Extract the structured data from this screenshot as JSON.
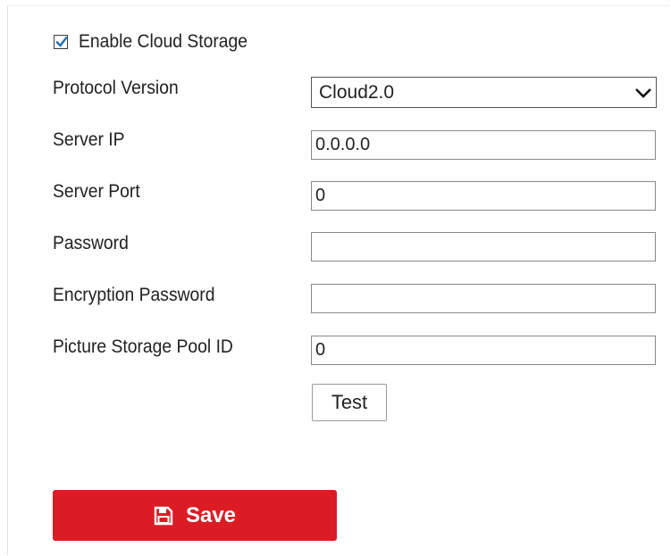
{
  "cloud_storage": {
    "enable_label": "Enable Cloud Storage",
    "enabled": true
  },
  "form": {
    "protocol_version": {
      "label": "Protocol Version",
      "value": "Cloud2.0"
    },
    "server_ip": {
      "label": "Server IP",
      "value": "0.0.0.0"
    },
    "server_port": {
      "label": "Server Port",
      "value": "0"
    },
    "password": {
      "label": "Password",
      "value": ""
    },
    "encryption_password": {
      "label": "Encryption Password",
      "value": ""
    },
    "picture_storage_pool_id": {
      "label": "Picture Storage Pool ID",
      "value": "0"
    }
  },
  "buttons": {
    "test_label": "Test",
    "save_label": "Save"
  },
  "icons": {
    "checkbox_check": "check-icon",
    "select_chevron": "chevron-down-icon",
    "save": "floppy-disk-icon"
  },
  "colors": {
    "save_button_bg": "#dc1c24",
    "check_mark": "#1f6fb7",
    "text": "#222222"
  }
}
